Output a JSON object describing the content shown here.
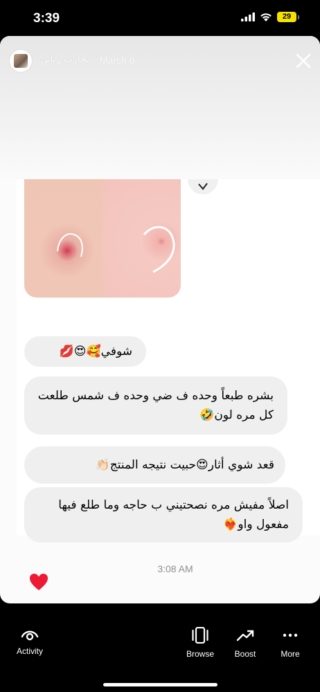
{
  "status_bar": {
    "time": "3:39",
    "battery": "29",
    "icons": [
      "cellular-signal-icon",
      "wifi-icon",
      "battery-icon"
    ]
  },
  "story": {
    "username": "تجارب زبائن",
    "date": "March 6"
  },
  "chat": {
    "messages": [
      "شوفي🥰😍💋",
      "بشره طبعاً وحده ف ضي وحده ف شمس طلعت كل مره لون🤣",
      "قعد شوي أثار😍حبيت نتيجه المنتج👏🏻",
      "اصلاً مفيش مره نصحتيني ب حاجه وما طلع فيها مفعول واو❤️‍🔥"
    ],
    "time": "3:08 AM"
  },
  "bottom_nav": {
    "activity": "Activity",
    "browse": "Browse",
    "boost": "Boost",
    "more": "More"
  },
  "colors": {
    "like_heart": "#ee1a35",
    "battery": "#f5e100"
  }
}
